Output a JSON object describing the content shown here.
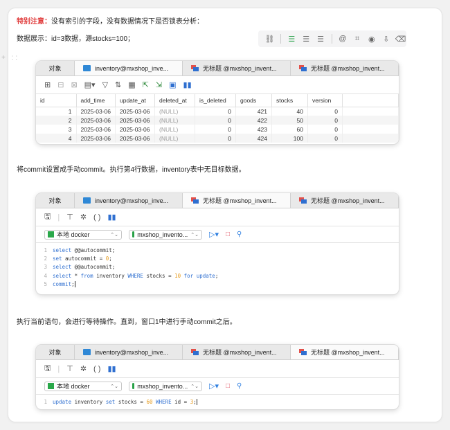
{
  "doc": {
    "line1_red": "特别注意：",
    "line1_rest": "没有索引的字段，没有数据情况下是否锁表分析：",
    "line2": "数据展示：id=3数据，源stocks=100；",
    "line3": "将commit设置成手动commit。执行第4行数据，inventory表中无目标数据。",
    "line4": "执行当前语句，会进行等待操作。直到，窗口1中进行手动commit之后。"
  },
  "floating_toolbar": {
    "icons": [
      "link-icon",
      "align-left-icon",
      "align-center-icon",
      "align-right-icon",
      "at-icon",
      "code-icon",
      "eye-icon",
      "download-icon",
      "trash-icon"
    ],
    "glyphs": [
      "🔗",
      "☰",
      "☰",
      "☰",
      "◉",
      "⌘",
      "◎",
      "⇩",
      "🗑"
    ]
  },
  "tabs": {
    "objects": "对象",
    "table_tab": "inventory@mxshop_inve...",
    "query_tab": "无标题 @mxshop_invent..."
  },
  "table": {
    "columns": [
      "id",
      "add_time",
      "update_at",
      "deleted_at",
      "is_deleted",
      "goods",
      "stocks",
      "version"
    ],
    "rows": [
      [
        "1",
        "2025-03-06",
        "2025-03-06",
        "(NULL)",
        "0",
        "421",
        "40",
        "0"
      ],
      [
        "2",
        "2025-03-06",
        "2025-03-06",
        "(NULL)",
        "0",
        "422",
        "50",
        "0"
      ],
      [
        "3",
        "2025-03-06",
        "2025-03-06",
        "(NULL)",
        "0",
        "423",
        "60",
        "0"
      ],
      [
        "4",
        "2025-03-06",
        "2025-03-06",
        "(NULL)",
        "0",
        "424",
        "100",
        "0"
      ]
    ]
  },
  "connection": {
    "server": "本地 docker",
    "database": "mxshop_invento..."
  },
  "editor1": {
    "lines": [
      [
        {
          "t": "select",
          "c": "kw"
        },
        {
          "t": " @@autocommit;",
          "c": "tx"
        }
      ],
      [
        {
          "t": "set",
          "c": "kw"
        },
        {
          "t": " autocommit = ",
          "c": "tx"
        },
        {
          "t": "0",
          "c": "nm"
        },
        {
          "t": ";",
          "c": "tx"
        }
      ],
      [
        {
          "t": "select",
          "c": "kw"
        },
        {
          "t": " @@autocommit;",
          "c": "tx"
        }
      ],
      [
        {
          "t": "select",
          "c": "kw"
        },
        {
          "t": " * ",
          "c": "tx"
        },
        {
          "t": "from",
          "c": "kw"
        },
        {
          "t": " inventory ",
          "c": "tx"
        },
        {
          "t": "WHERE",
          "c": "kw"
        },
        {
          "t": " stocks = ",
          "c": "tx"
        },
        {
          "t": "10",
          "c": "nm"
        },
        {
          "t": " ",
          "c": "tx"
        },
        {
          "t": "for update",
          "c": "kw"
        },
        {
          "t": ";",
          "c": "tx"
        }
      ],
      [
        {
          "t": "commit",
          "c": "kw"
        },
        {
          "t": ";",
          "c": "tx"
        }
      ]
    ],
    "line_numbers": [
      "1",
      "2",
      "3",
      "4",
      "5"
    ]
  },
  "editor2": {
    "lines": [
      [
        {
          "t": "update",
          "c": "kw"
        },
        {
          "t": " inventory ",
          "c": "tx"
        },
        {
          "t": "set",
          "c": "kw"
        },
        {
          "t": " stocks = ",
          "c": "tx"
        },
        {
          "t": "60",
          "c": "nm"
        },
        {
          "t": " ",
          "c": "tx"
        },
        {
          "t": "WHERE",
          "c": "kw"
        },
        {
          "t": " id = ",
          "c": "tx"
        },
        {
          "t": "3",
          "c": "nm"
        },
        {
          "t": ";",
          "c": "tx"
        }
      ]
    ],
    "line_numbers": [
      "1"
    ]
  }
}
